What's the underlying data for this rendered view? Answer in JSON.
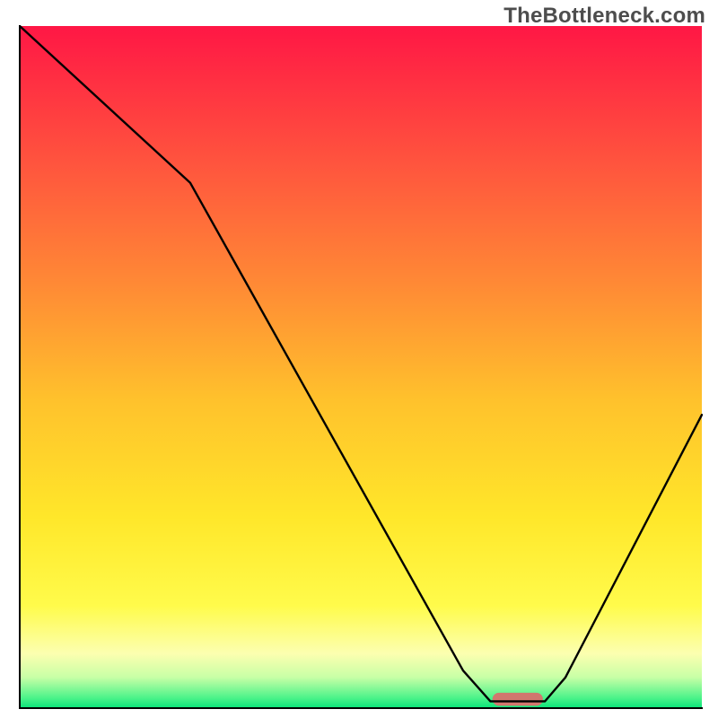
{
  "watermark": "TheBottleneck.com",
  "chart_data": {
    "type": "line",
    "title": "",
    "xlabel": "",
    "ylabel": "",
    "xlim": [
      0,
      100
    ],
    "ylim": [
      0,
      100
    ],
    "gradient_stops": [
      {
        "offset": 0.0,
        "color": "#ff1745"
      },
      {
        "offset": 0.22,
        "color": "#ff5a3d"
      },
      {
        "offset": 0.38,
        "color": "#ff8a35"
      },
      {
        "offset": 0.55,
        "color": "#ffc22c"
      },
      {
        "offset": 0.72,
        "color": "#ffe72a"
      },
      {
        "offset": 0.85,
        "color": "#fffb4b"
      },
      {
        "offset": 0.92,
        "color": "#fcffb0"
      },
      {
        "offset": 0.955,
        "color": "#c7ffa6"
      },
      {
        "offset": 0.985,
        "color": "#4cf38a"
      },
      {
        "offset": 1.0,
        "color": "#08e379"
      }
    ],
    "curve": [
      {
        "xn": 0.0,
        "yn": 1.0
      },
      {
        "xn": 0.25,
        "yn": 0.77
      },
      {
        "xn": 0.65,
        "yn": 0.055
      },
      {
        "xn": 0.69,
        "yn": 0.01
      },
      {
        "xn": 0.77,
        "yn": 0.01
      },
      {
        "xn": 0.8,
        "yn": 0.045
      },
      {
        "xn": 1.0,
        "yn": 0.43
      }
    ],
    "marker": {
      "xn": 0.73,
      "yn": 0.013,
      "wn": 0.074,
      "hn": 0.019,
      "color": "#d1776e"
    },
    "axis": {
      "color": "#000000",
      "width": 2
    }
  }
}
